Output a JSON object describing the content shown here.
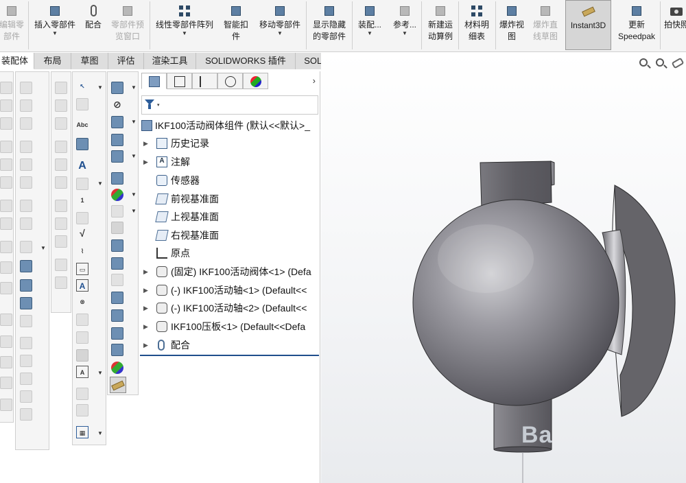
{
  "ribbon": {
    "buttons": [
      {
        "label": "编辑零\n部件",
        "icon": "edit-component-icon",
        "disabled": true,
        "dropdown": false
      },
      {
        "label": "插入零部件",
        "icon": "insert-components-icon",
        "disabled": false,
        "dropdown": true
      },
      {
        "label": "配合",
        "icon": "mate-icon",
        "disabled": false,
        "dropdown": false
      },
      {
        "label": "零部件预\n览窗口",
        "icon": "component-preview-icon",
        "disabled": true,
        "dropdown": false
      },
      {
        "label": "线性零部件阵列",
        "icon": "linear-pattern-icon",
        "disabled": false,
        "dropdown": true
      },
      {
        "label": "智能扣\n件",
        "icon": "smart-fasteners-icon",
        "disabled": false,
        "dropdown": false
      },
      {
        "label": "移动零部件",
        "icon": "move-component-icon",
        "disabled": false,
        "dropdown": true
      },
      {
        "label": "显示隐藏\n的零部件",
        "icon": "show-hidden-components-icon",
        "disabled": false,
        "dropdown": false
      },
      {
        "label": "装配...",
        "icon": "assembly-features-icon",
        "disabled": false,
        "dropdown": true
      },
      {
        "label": "参考...",
        "icon": "reference-geometry-icon",
        "disabled": false,
        "dropdown": true
      },
      {
        "label": "新建运\n动算例",
        "icon": "new-motion-study-icon",
        "disabled": false,
        "dropdown": false
      },
      {
        "label": "材料明\n细表",
        "icon": "bill-of-materials-icon",
        "disabled": false,
        "dropdown": false
      },
      {
        "label": "爆炸视\n图",
        "icon": "exploded-view-icon",
        "disabled": false,
        "dropdown": false
      },
      {
        "label": "爆炸直\n线草图",
        "icon": "explode-line-sketch-icon",
        "disabled": true,
        "dropdown": false
      },
      {
        "label": "Instant3D",
        "icon": "instant3d-icon",
        "disabled": false,
        "dropdown": false,
        "active": true
      },
      {
        "label": "更新\nSpeedpak",
        "icon": "update-speedpak-icon",
        "disabled": false,
        "dropdown": false
      },
      {
        "label": "拍快照",
        "icon": "take-snapshot-icon",
        "disabled": false,
        "dropdown": false
      }
    ]
  },
  "tabs": [
    "装配体",
    "布局",
    "草图",
    "评估",
    "渲染工具",
    "SOLIDWORKS 插件",
    "SOLIDWORKS MBD"
  ],
  "panel": {
    "filter_dropdown": "▾",
    "expand_glyph": "›",
    "tree": [
      {
        "label": "IKF100活动阀体组件 (默认<<默认>_",
        "icon": "assembly-icon",
        "expander": false
      },
      {
        "label": "历史记录",
        "icon": "history-folder-icon",
        "expander": true
      },
      {
        "label": "注解",
        "icon": "annotations-icon",
        "expander": true
      },
      {
        "label": "传感器",
        "icon": "sensors-icon",
        "expander": false
      },
      {
        "label": "前视基准面",
        "icon": "plane-icon",
        "expander": false
      },
      {
        "label": "上视基准面",
        "icon": "plane-icon",
        "expander": false
      },
      {
        "label": "右视基准面",
        "icon": "plane-icon",
        "expander": false
      },
      {
        "label": "原点",
        "icon": "origin-icon",
        "expander": false
      },
      {
        "label": "(固定) IKF100活动阀体<1> (Defa",
        "icon": "part-icon",
        "expander": true
      },
      {
        "label": "(-) IKF100活动轴<1> (Default<<",
        "icon": "part-icon",
        "expander": true
      },
      {
        "label": "(-) IKF100活动轴<2> (Default<<",
        "icon": "part-icon",
        "expander": true
      },
      {
        "label": "IKF100压板<1> (Default<<Defa",
        "icon": "part-icon",
        "expander": true
      },
      {
        "label": "配合",
        "icon": "mates-icon",
        "expander": true
      }
    ]
  },
  "viewport": {
    "watermark": "Ba",
    "tools": [
      "zoom-to-fit-icon",
      "zoom-to-area-icon",
      "previous-view-icon"
    ]
  },
  "colors": {
    "ribbon_bg": "#f4f4f4",
    "active_tab": "#ffffff",
    "tree_accent": "#1f4e8c",
    "model_gray": "#6b6a70"
  }
}
